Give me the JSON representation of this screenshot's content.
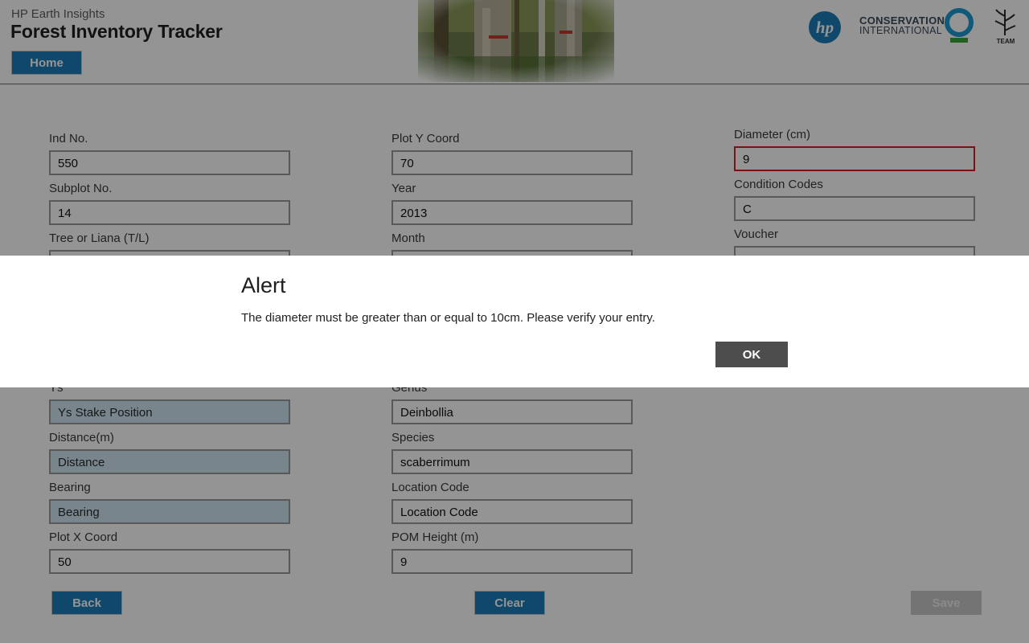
{
  "header": {
    "subtitle": "HP Earth Insights",
    "title": "Forest Inventory Tracker",
    "home_label": "Home",
    "hp_logo_text": "hp",
    "ci_line1": "CONSERVATION",
    "ci_line2": "INTERNATIONAL",
    "team_text": "TEAM"
  },
  "form": {
    "col1": [
      {
        "label": "Ind No.",
        "value": "550",
        "placeholder": false
      },
      {
        "label": "Subplot No.",
        "value": "14",
        "placeholder": false
      },
      {
        "label": "Tree or Liana (T/L)",
        "value": "",
        "placeholder": false
      },
      {
        "label": "",
        "value": "",
        "placeholder": false
      },
      {
        "label": "",
        "value": "",
        "placeholder": false
      },
      {
        "label": "Ys",
        "value": "Ys Stake Position",
        "placeholder": true
      },
      {
        "label": "Distance(m)",
        "value": "Distance",
        "placeholder": true
      },
      {
        "label": "Bearing",
        "value": "Bearing",
        "placeholder": true
      },
      {
        "label": "Plot X Coord",
        "value": "50",
        "placeholder": false
      }
    ],
    "col2": [
      {
        "label": "Plot Y Coord",
        "value": "70",
        "placeholder": false
      },
      {
        "label": "Year",
        "value": "2013",
        "placeholder": false
      },
      {
        "label": "Month",
        "value": "",
        "placeholder": false
      },
      {
        "label": "",
        "value": "",
        "placeholder": false
      },
      {
        "label": "",
        "value": "",
        "placeholder": false
      },
      {
        "label": "Genus",
        "value": "Deinbollia",
        "placeholder": false
      },
      {
        "label": "Species",
        "value": "scaberrimum",
        "placeholder": false
      },
      {
        "label": "Location Code",
        "value": "Location Code",
        "placeholder": true
      },
      {
        "label": "POM Height (m)",
        "value": "9",
        "placeholder": false
      }
    ],
    "col3": [
      {
        "label": "Diameter (cm)",
        "value": "9",
        "placeholder": false,
        "error": true
      },
      {
        "label": "Condition Codes",
        "value": "C",
        "placeholder": false
      },
      {
        "label": "Voucher",
        "value": "",
        "placeholder": false
      }
    ]
  },
  "footer": {
    "back_label": "Back",
    "clear_label": "Clear",
    "save_label": "Save"
  },
  "alert": {
    "title": "Alert",
    "message": "The diameter must be greater than or equal to 10cm. Please verify your entry.",
    "ok_label": "OK"
  },
  "colors": {
    "accent": "#1b7db8",
    "error_border": "#d11f1f",
    "placeholder_fill": "#cfe6f3",
    "ok_button": "#4d4d4d"
  }
}
